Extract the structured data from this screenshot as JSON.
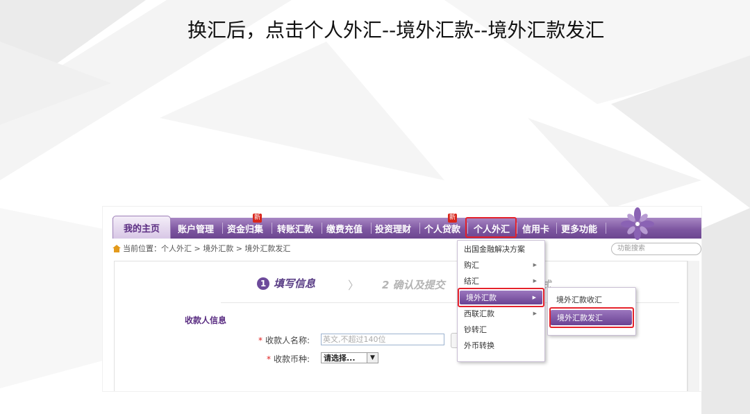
{
  "slide": {
    "title": "换汇后，点击个人外汇--境外汇款--境外汇款发汇"
  },
  "nav": {
    "home": "我的主页",
    "items": [
      "账户管理",
      "资金归集",
      "转账汇款",
      "缴费充值",
      "投资理财",
      "个人贷款",
      "个人外汇",
      "信用卡",
      "更多功能"
    ],
    "new_badge": "新"
  },
  "breadcrumb": {
    "text": "当前位置：个人外汇 > 境外汇款 > 境外汇款发汇"
  },
  "search": {
    "placeholder": "功能搜索"
  },
  "steps": {
    "step1_num": "1",
    "step1_label": "填写信息",
    "arrow": "〉",
    "step2_label": "2 确认及提交",
    "step3_fragment": "式"
  },
  "form": {
    "section_title": "收款人信息",
    "payee_name_label": "收款人名称:",
    "payee_name_placeholder": "英文,不超过140位",
    "currency_label": "收款币种:",
    "currency_value": "请选择...",
    "required_mark": "*"
  },
  "dropdown": {
    "items": [
      {
        "label": "出国金融解决方案",
        "has_sub": false
      },
      {
        "label": "购汇",
        "has_sub": true
      },
      {
        "label": "结汇",
        "has_sub": true
      },
      {
        "label": "境外汇款",
        "has_sub": true,
        "active": true
      },
      {
        "label": "西联汇款",
        "has_sub": true
      },
      {
        "label": "钞转汇",
        "has_sub": false
      },
      {
        "label": "外币转换",
        "has_sub": false
      }
    ],
    "arrow_glyph": "▶"
  },
  "submenu": {
    "items": [
      "境外汇款收汇",
      "境外汇款发汇"
    ],
    "active_index": 1
  },
  "colors": {
    "nav_purple": "#7e57a1",
    "highlight_red": "#e5222b",
    "menu_active": "#6a4293"
  }
}
